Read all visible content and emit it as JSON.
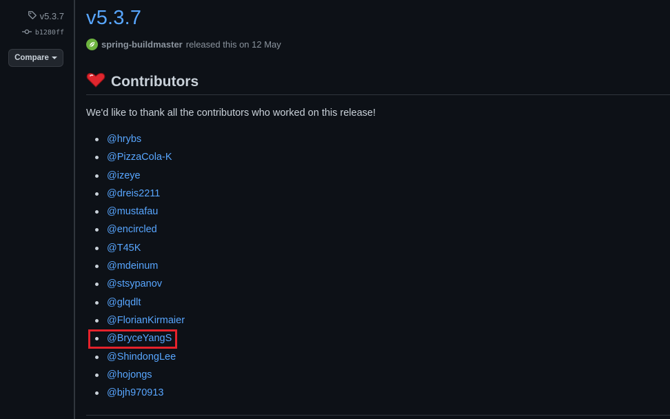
{
  "sidebar": {
    "tag_label": "v5.3.7",
    "commit_label": "b1280ff",
    "compare_label": "Compare"
  },
  "release": {
    "title": "v5.3.7",
    "author": "spring-buildmaster",
    "released_text": "released this on 12 May"
  },
  "contributors": {
    "heading": "Contributors",
    "thanks_text": "We'd like to thank all the contributors who worked on this release!",
    "items": [
      "@hrybs",
      "@PizzaCola-K",
      "@izeye",
      "@dreis2211",
      "@mustafau",
      "@encircled",
      "@T45K",
      "@mdeinum",
      "@stsypanov",
      "@glqdlt",
      "@FlorianKirmaier",
      "@BryceYangS",
      "@ShindongLee",
      "@hojongs",
      "@bjh970913"
    ],
    "highlighted": "@BryceYangS"
  },
  "icons": {
    "tag": "tag-icon",
    "commit": "git-commit-icon",
    "caret": "triangle-down-icon",
    "author_avatar": "spring-logo-icon",
    "heading_emoji": "red-heart-icon"
  },
  "colors": {
    "background": "#0d1117",
    "link": "#58a6ff",
    "text": "#c9d1d9",
    "muted": "#8b949e",
    "highlight": "#e5222b",
    "spring_green": "#6db33f"
  }
}
